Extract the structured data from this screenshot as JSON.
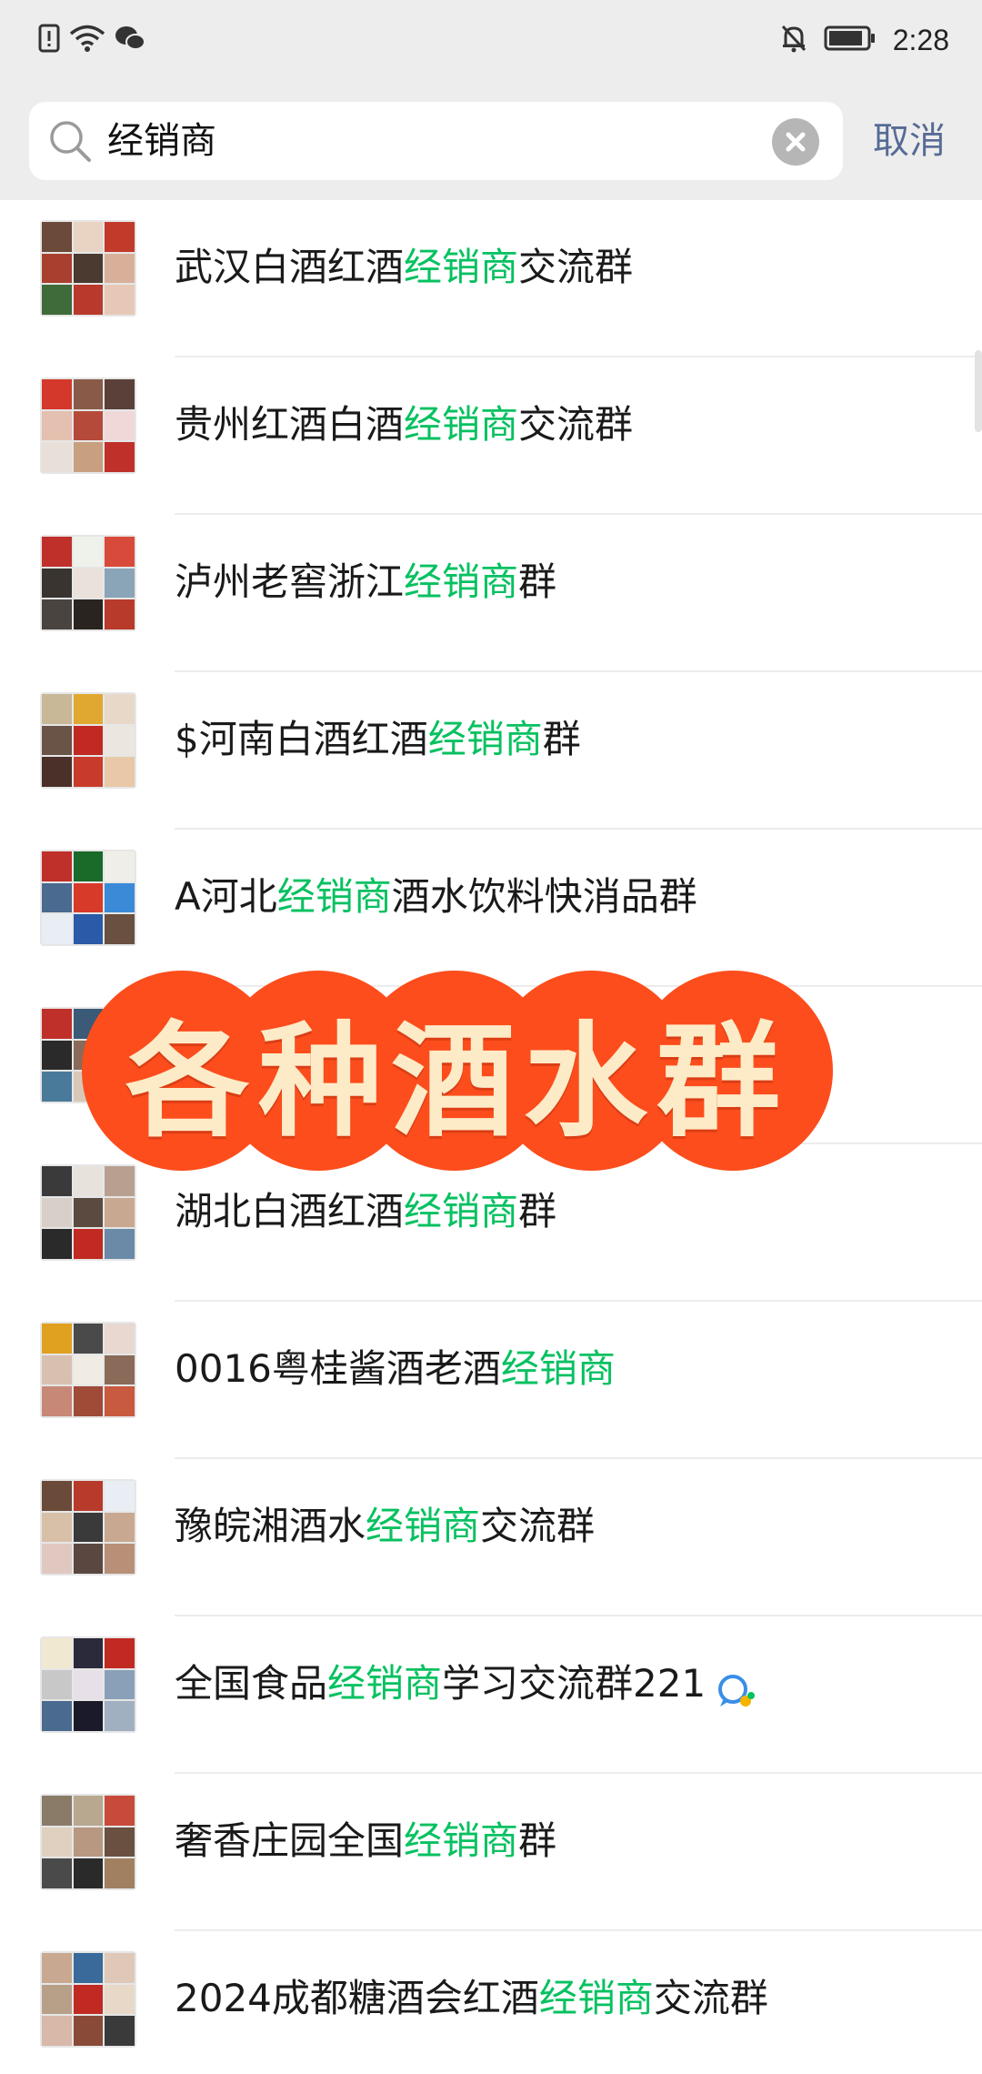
{
  "status_bar": {
    "time": "2:28",
    "left_icons": [
      "alert-icon",
      "wifi-icon",
      "wechat-icon"
    ],
    "right_icons": [
      "bell-muted-icon",
      "battery-icon"
    ]
  },
  "search": {
    "query": "经销商",
    "cancel_label": "取消",
    "highlight_color": "#07c160",
    "cancel_color": "#576b95"
  },
  "results": [
    {
      "pre": "武汉白酒红酒",
      "hl": "经销商",
      "post": "交流群"
    },
    {
      "pre": "贵州红酒白酒",
      "hl": "经销商",
      "post": "交流群"
    },
    {
      "pre": "泸州老窖浙江",
      "hl": "经销商",
      "post": "群"
    },
    {
      "pre": "$河南白酒红酒",
      "hl": "经销商",
      "post": "群"
    },
    {
      "pre": "A河北",
      "hl": "经销商",
      "post": "酒水饮料快消品群"
    },
    {
      "pre": "",
      "hl": "",
      "post": ""
    },
    {
      "pre": "湖北白酒红酒",
      "hl": "经销商",
      "post": "群"
    },
    {
      "pre": "0016粤桂酱酒老酒",
      "hl": "经销商",
      "post": ""
    },
    {
      "pre": "豫皖湘酒水",
      "hl": "经销商",
      "post": "交流群"
    },
    {
      "pre": "全国食品",
      "hl": "经销商",
      "post": "学习交流群221"
    },
    {
      "pre": "奢香庄园全国",
      "hl": "经销商",
      "post": "群"
    },
    {
      "pre": "2024成都糖酒会红酒",
      "hl": "经销商",
      "post": "交流群"
    }
  ],
  "banner": {
    "text": "各种酒水群",
    "color": "#fd4d1c",
    "text_color": "#fdebc8"
  }
}
